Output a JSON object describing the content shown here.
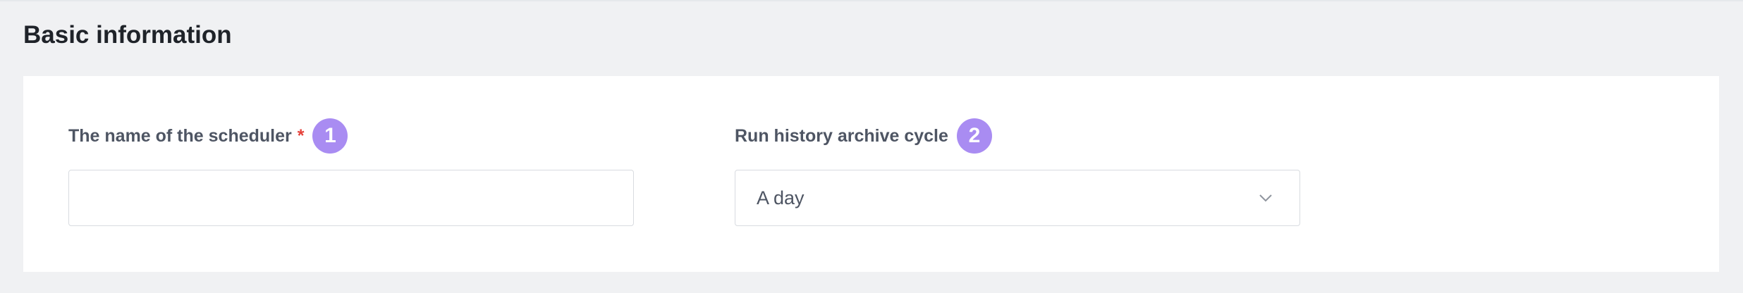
{
  "section": {
    "title": "Basic information"
  },
  "form": {
    "scheduler_name": {
      "label": "The name of the scheduler",
      "required_mark": "*",
      "step": "1",
      "value": "",
      "placeholder": ""
    },
    "archive_cycle": {
      "label": "Run history archive cycle",
      "step": "2",
      "selected": "A day"
    }
  },
  "colors": {
    "badge": "#a98cf2",
    "required": "#e5413a"
  },
  "icons": {
    "select_arrow": "chevron-down-icon"
  }
}
